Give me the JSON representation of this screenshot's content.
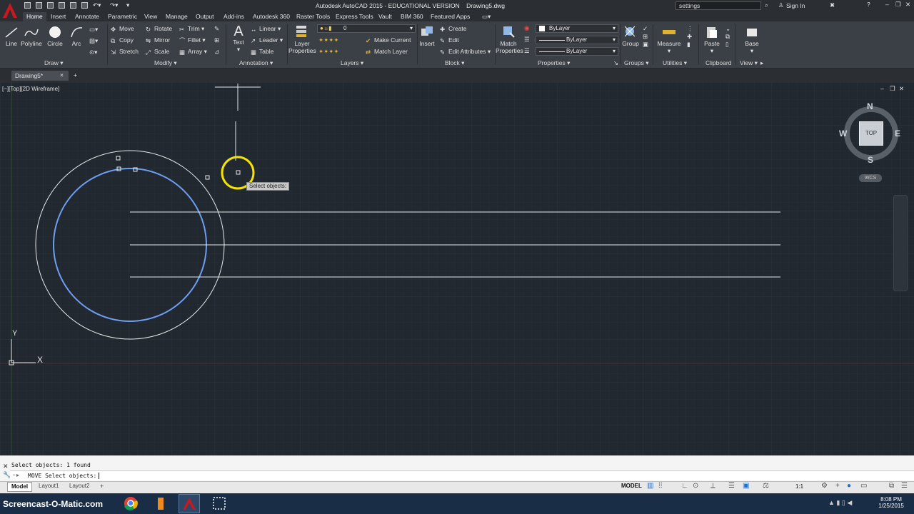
{
  "app": {
    "title": "Autodesk AutoCAD 2015 - EDUCATIONAL VERSION",
    "file": "Drawing5.dwg",
    "search_value": "settings",
    "sign_in": "Sign In"
  },
  "ribbon": {
    "tabs": [
      "Home",
      "Insert",
      "Annotate",
      "Parametric",
      "View",
      "Manage",
      "Output",
      "Add-ins",
      "Autodesk 360",
      "Raster Tools",
      "Express Tools",
      "Vault",
      "BIM 360",
      "Featured Apps"
    ],
    "draw": {
      "line": "Line",
      "polyline": "Polyline",
      "circle": "Circle",
      "arc": "Arc",
      "panel": "Draw"
    },
    "modify": {
      "move": "Move",
      "rotate": "Rotate",
      "trim": "Trim",
      "copy": "Copy",
      "mirror": "Mirror",
      "fillet": "Fillet",
      "stretch": "Stretch",
      "scale": "Scale",
      "array": "Array",
      "panel": "Modify"
    },
    "annotation": {
      "text": "Text",
      "linear": "Linear",
      "leader": "Leader",
      "table": "Table",
      "panel": "Annotation"
    },
    "layers": {
      "layer_properties": [
        "Layer",
        "Properties"
      ],
      "current_layer": "0",
      "make_current": "Make Current",
      "match_layer": "Match Layer",
      "panel": "Layers"
    },
    "block": {
      "insert": "Insert",
      "create": "Create",
      "edit": "Edit",
      "edit_attributes": "Edit Attributes",
      "panel": "Block"
    },
    "properties": {
      "match_properties": [
        "Match",
        "Properties"
      ],
      "color": "ByLayer",
      "linetype": "ByLayer",
      "lineweight": "ByLayer",
      "panel": "Properties"
    },
    "groups": {
      "group": "Group",
      "panel": "Groups"
    },
    "utilities": {
      "measure": "Measure",
      "panel": "Utilities"
    },
    "clipboard": {
      "paste": "Paste",
      "panel": "Clipboard"
    },
    "view": {
      "base": "Base",
      "panel": "View"
    }
  },
  "file_tabs": [
    "Drawing5*"
  ],
  "viewport": {
    "label": "[−][Top][2D Wireframe]",
    "tooltip": "Select objects:",
    "ucs_x": "X",
    "ucs_y": "Y"
  },
  "viewcube": {
    "north": "N",
    "south": "S",
    "east": "E",
    "west": "W",
    "face": "TOP",
    "wcs": "WCS"
  },
  "command": {
    "history": "Select objects: 1 found",
    "prompt": "MOVE Select objects:"
  },
  "status": {
    "tabs": [
      "Model",
      "Layout1",
      "Layout2"
    ],
    "mode": "MODEL",
    "scale": "1:1"
  },
  "taskbar": {
    "watermark": "Screencast-O-Matic.com",
    "time": "8:08 PM",
    "date": "1/25/2015"
  },
  "colors": {
    "canvas": "#212830",
    "ribbon": "#3b4046",
    "selected_circle": "#6d9ef2",
    "cursor_highlight": "#f5e400",
    "autocad_red": "#c8191e",
    "taskbar": "#1a2d46"
  }
}
